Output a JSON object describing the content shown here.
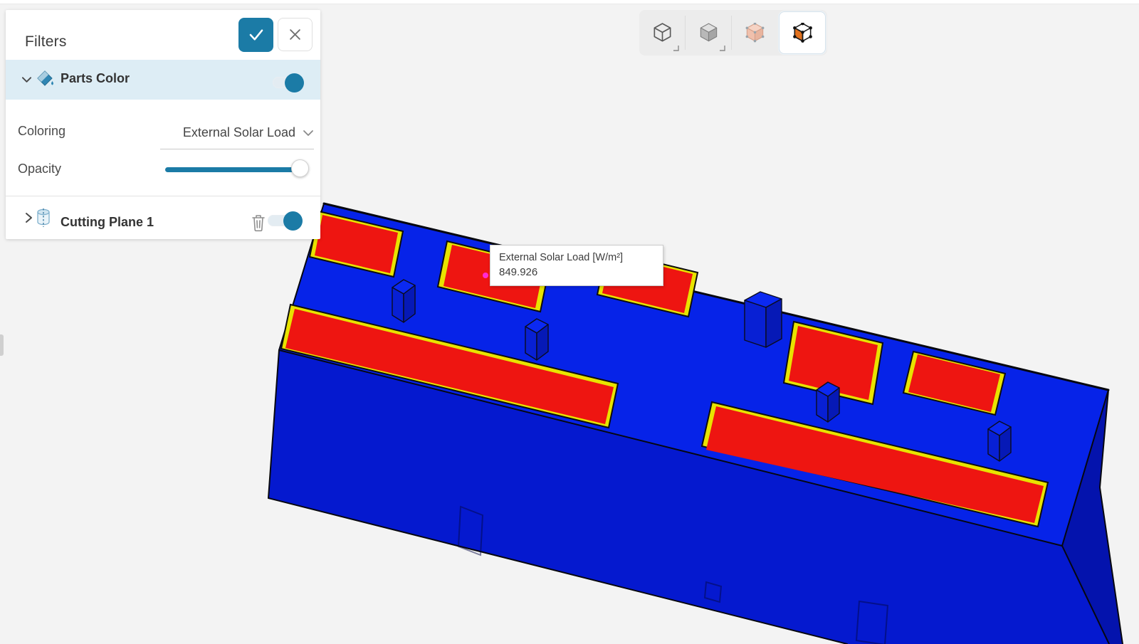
{
  "page": {
    "background": "#f3f3f3"
  },
  "filters_panel": {
    "title": "Filters",
    "rows": {
      "parts_color": {
        "label": "Parts Color",
        "enabled": true
      },
      "coloring": {
        "label": "Coloring",
        "value": "External Solar Load"
      },
      "opacity": {
        "label": "Opacity",
        "percent": 100
      },
      "cutting_plane": {
        "label": "Cutting Plane 1",
        "enabled": true
      }
    }
  },
  "view_toolbar": {
    "buttons": [
      "wireframe-view",
      "solid-view",
      "surface-view",
      "topology-view"
    ],
    "active": "topology-view"
  },
  "probe_tooltip": {
    "title": "External Solar Load [W/m²]",
    "value": "849.926"
  },
  "scene": {
    "description": "3D box model colored by external solar load",
    "colors": {
      "top_face": "#0623e8",
      "front_face": "#0519cf",
      "side_face": "#0413ad",
      "hot_patch": "#ee1511",
      "patch_fringe": "#e8e300",
      "edge": "#06070f",
      "probe_marker": "#ff2ad4"
    }
  },
  "icons": [
    "check-icon",
    "close-icon",
    "chevron-down-icon",
    "chevron-right-icon",
    "paint-bucket-icon",
    "cutting-plane-icon",
    "trash-icon",
    "wireframe-cube-icon",
    "solid-cube-icon",
    "surface-cube-icon",
    "topology-cube-icon"
  ]
}
